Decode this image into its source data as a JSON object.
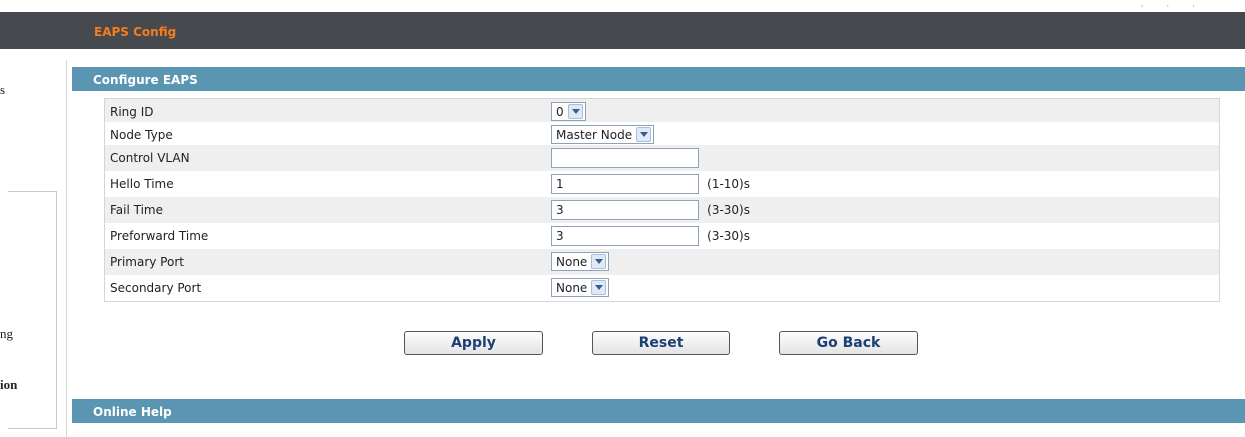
{
  "header": {
    "title": "EAPS Config"
  },
  "sidebar": {
    "fragments": [
      "s",
      "ng",
      "ion"
    ]
  },
  "sections": {
    "configure": "Configure EAPS",
    "help": "Online Help"
  },
  "form": {
    "ring_id": {
      "label": "Ring ID",
      "value": "0"
    },
    "node_type": {
      "label": "Node Type",
      "value": "Master Node"
    },
    "control_vlan": {
      "label": "Control VLAN",
      "value": ""
    },
    "hello_time": {
      "label": "Hello Time",
      "value": "1",
      "range": "(1-10)s"
    },
    "fail_time": {
      "label": "Fail Time",
      "value": "3",
      "range": "(3-30)s"
    },
    "preforward_time": {
      "label": "Preforward Time",
      "value": "3",
      "range": "(3-30)s"
    },
    "primary_port": {
      "label": "Primary Port",
      "value": "None"
    },
    "secondary_port": {
      "label": "Secondary Port",
      "value": "None"
    }
  },
  "buttons": {
    "apply": "Apply",
    "reset": "Reset",
    "go_back": "Go Back"
  },
  "colors": {
    "topbar": "#46494d",
    "title_accent": "#f57c1f",
    "section_bar": "#5a95b2",
    "button_text": "#1b3f73"
  },
  "icons": {
    "select_arrow": "chevron-down-icon"
  }
}
